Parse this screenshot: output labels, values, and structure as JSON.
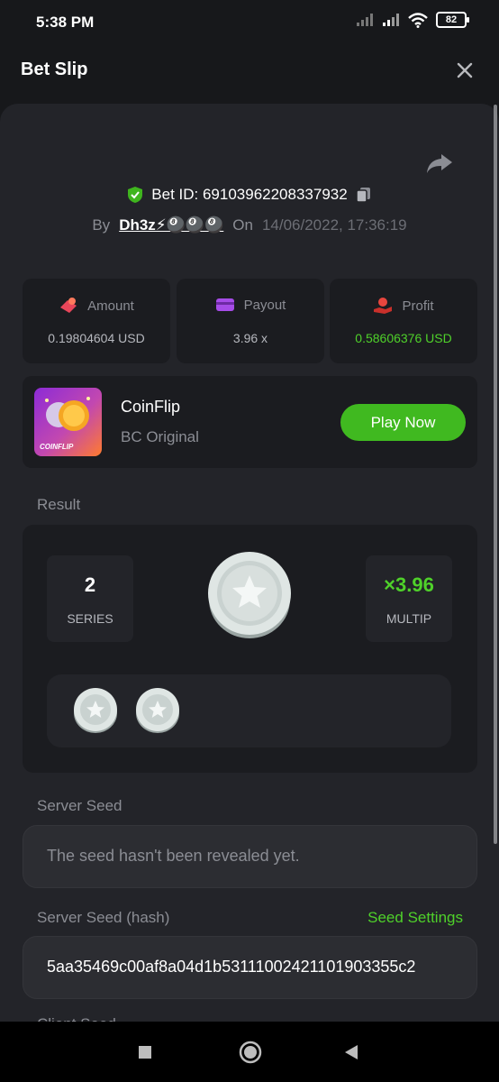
{
  "status_bar": {
    "time": "5:38 PM",
    "battery": "82"
  },
  "header": {
    "title": "Bet Slip"
  },
  "bet": {
    "id_label": "Bet ID: 69103962208337932",
    "by_label": "By",
    "user": "Dh3z⚡🎱🎱🎱",
    "on_label": "On",
    "date": "14/06/2022, 17:36:19"
  },
  "stats": [
    {
      "label": "Amount",
      "value": "0.19804604 USD",
      "icon": "amount-icon",
      "color": "#e8465a"
    },
    {
      "label": "Payout",
      "value": "3.96 x",
      "icon": "wallet-icon",
      "color": "#a64ce8"
    },
    {
      "label": "Profit",
      "value": "0.58606376 USD",
      "icon": "profit-hand-icon",
      "color": "#e8463e"
    }
  ],
  "game": {
    "name": "CoinFlip",
    "subtitle": "BC Original",
    "thumb_label": "COINFLIP",
    "play_label": "Play Now"
  },
  "result": {
    "label": "Result",
    "series_value": "2",
    "series_label": "SERIES",
    "multiplier_value": "×3.96",
    "multiplier_label": "MULTIP",
    "history_count": 2
  },
  "server_seed": {
    "label": "Server Seed",
    "placeholder": "The seed hasn't been revealed yet."
  },
  "server_seed_hash": {
    "label": "Server Seed (hash)",
    "settings_label": "Seed Settings",
    "value": "5aa35469c00af8a04d1b53111002421101903355c2"
  },
  "client_seed": {
    "label": "Client Seed"
  },
  "colors": {
    "accent_green": "#40b920",
    "text_green": "#4fd12a",
    "background": "#17181b",
    "panel": "#232429"
  }
}
